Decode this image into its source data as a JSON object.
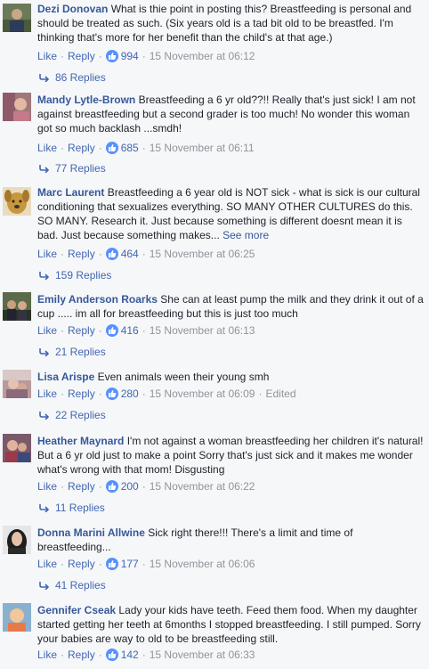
{
  "actions": {
    "like": "Like",
    "reply": "Reply",
    "sep": "·",
    "edited": "Edited"
  },
  "comments": [
    {
      "author": "Dezi Donovan",
      "text": "What is thie point in posting this? Breastfeeding is personal and should be treated as such. (Six years old is a tad bit old to be breastfed. I'm thinking that's more for her benefit than the child's at that age.)",
      "likes": "994",
      "timestamp": "15 November at 06:12",
      "replies": "86 Replies",
      "avatar_color": "#6b7a5a"
    },
    {
      "author": "Mandy Lytle-Brown",
      "text": "Breastfeeding a 6 yr old??!! Really that's just sick! I am not against breastfeeding but a second grader is too much! No wonder this woman got so much backlash ...smdh!",
      "likes": "685",
      "timestamp": "15 November at 06:11",
      "replies": "77 Replies",
      "avatar_color": "#a0787a"
    },
    {
      "author": "Marc Laurent",
      "text": "Breastfeeding a 6 year old is NOT sick - what is sick is our cultural conditioning that sexualizes everything. SO MANY OTHER CULTURES do this. SO MANY. Research it. Just because something is different doesnt mean it is bad. Just because something makes...",
      "see_more": "See more",
      "likes": "464",
      "timestamp": "15 November at 06:25",
      "replies": "159 Replies",
      "avatar_color": "#c8963c"
    },
    {
      "author": "Emily Anderson Roarks",
      "text": "She can at least pump the milk and they drink it out of a cup ..... im all for breastfeeding but this is just too much",
      "likes": "416",
      "timestamp": "15 November at 06:13",
      "replies": "21 Replies",
      "avatar_color": "#3c4a3a"
    },
    {
      "author": "Lisa Arispe",
      "text": "Even animals ween their young smh",
      "likes": "280",
      "timestamp": "15 November at 06:09",
      "edited": true,
      "replies": "22 Replies",
      "avatar_color": "#b89a9a"
    },
    {
      "author": "Heather Maynard",
      "text": "I'm not against a woman breastfeeding her children it's natural! But a 6 yr old just to make a point Sorry that's just sick and it makes me wonder what's wrong with that mom! Disgusting",
      "likes": "200",
      "timestamp": "15 November at 06:22",
      "replies": "11 Replies",
      "avatar_color": "#7a5a6a"
    },
    {
      "author": "Donna Marini Allwine",
      "text": "Sick right there!!! There's a limit and time of breastfeeding...",
      "likes": "177",
      "timestamp": "15 November at 06:06",
      "replies": "41 Replies",
      "avatar_color": "#2a2a2a"
    },
    {
      "author": "Gennifer Cseak",
      "text": "Lady your kids have teeth. Feed them food. When my daughter started getting her teeth at 6months I stopped breastfeeding. I still pumped. Sorry your babies are way to old to be breastfeeding still.",
      "likes": "142",
      "timestamp": "15 November at 06:33",
      "avatar_color": "#d9a86a"
    }
  ]
}
